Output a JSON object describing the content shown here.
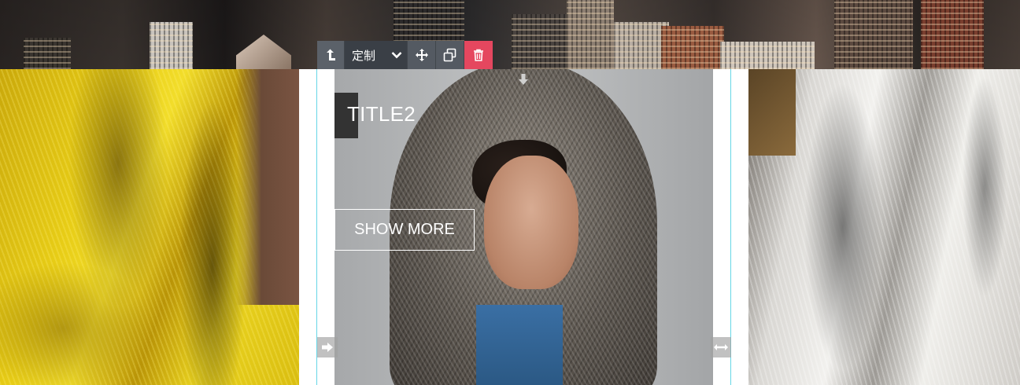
{
  "toolbar": {
    "parent_icon": "select-parent-icon",
    "custom_label": "定制",
    "dropdown_icon": "chevron-down-icon",
    "move_icon": "move-icon",
    "copy_icon": "duplicate-icon",
    "delete_icon": "trash-icon"
  },
  "slide": {
    "title": "TITLE2",
    "button_label": "SHOW MORE"
  },
  "handles": {
    "top_icon": "arrow-down-icon",
    "left_icon": "arrow-right-icon",
    "right_icon": "resize-horizontal-icon"
  },
  "colors": {
    "accent_border": "#66d6e6",
    "delete": "#e5475f",
    "toolbar": "#545a62"
  }
}
